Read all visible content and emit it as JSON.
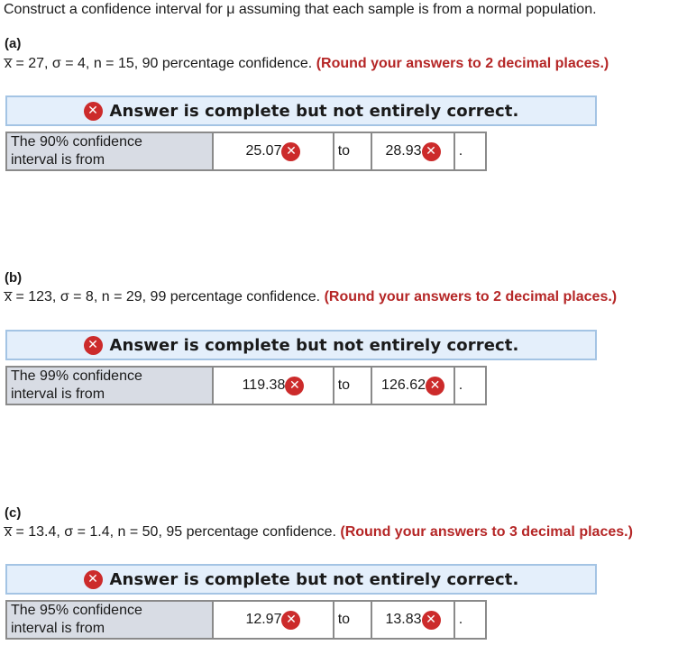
{
  "intro": "Construct a confidence interval for μ assuming that each sample is from a normal population.",
  "error_mark": "✕",
  "parts": [
    {
      "label": "(a)",
      "given": "x̅ = 27, σ = 4, n = 15, 90 percentage confidence.",
      "instruction": "(Round your answers to 2 decimal places.)",
      "banner": "Answer is complete but not entirely correct.",
      "row_label_line1": "The 90% confidence",
      "row_label_line2": "interval is from",
      "lower": "25.07",
      "connector": "to",
      "upper": "28.93",
      "end": "."
    },
    {
      "label": "(b)",
      "given": "x̅ = 123, σ = 8, n = 29, 99 percentage confidence.",
      "instruction": "(Round your answers to 2 decimal places.)",
      "banner": "Answer is complete but not entirely correct.",
      "row_label_line1": "The 99% confidence",
      "row_label_line2": "interval is from",
      "lower": "119.38",
      "connector": "to",
      "upper": "126.62",
      "end": "."
    },
    {
      "label": "(c)",
      "given": "x̅ = 13.4, σ = 1.4, n = 50, 95 percentage confidence.",
      "instruction": "(Round your answers to 3 decimal places.)",
      "banner": "Answer is complete but not entirely correct.",
      "row_label_line1": "The 95% confidence",
      "row_label_line2": "interval is from",
      "lower": "12.97",
      "connector": "to",
      "upper": "13.83",
      "end": "."
    }
  ],
  "colors": {
    "error_red": "#cc2b2b",
    "instruction_red": "#b52626",
    "banner_bg": "#e4effb",
    "banner_border": "#a4c4e4",
    "label_cell_bg": "#d8dce4"
  }
}
